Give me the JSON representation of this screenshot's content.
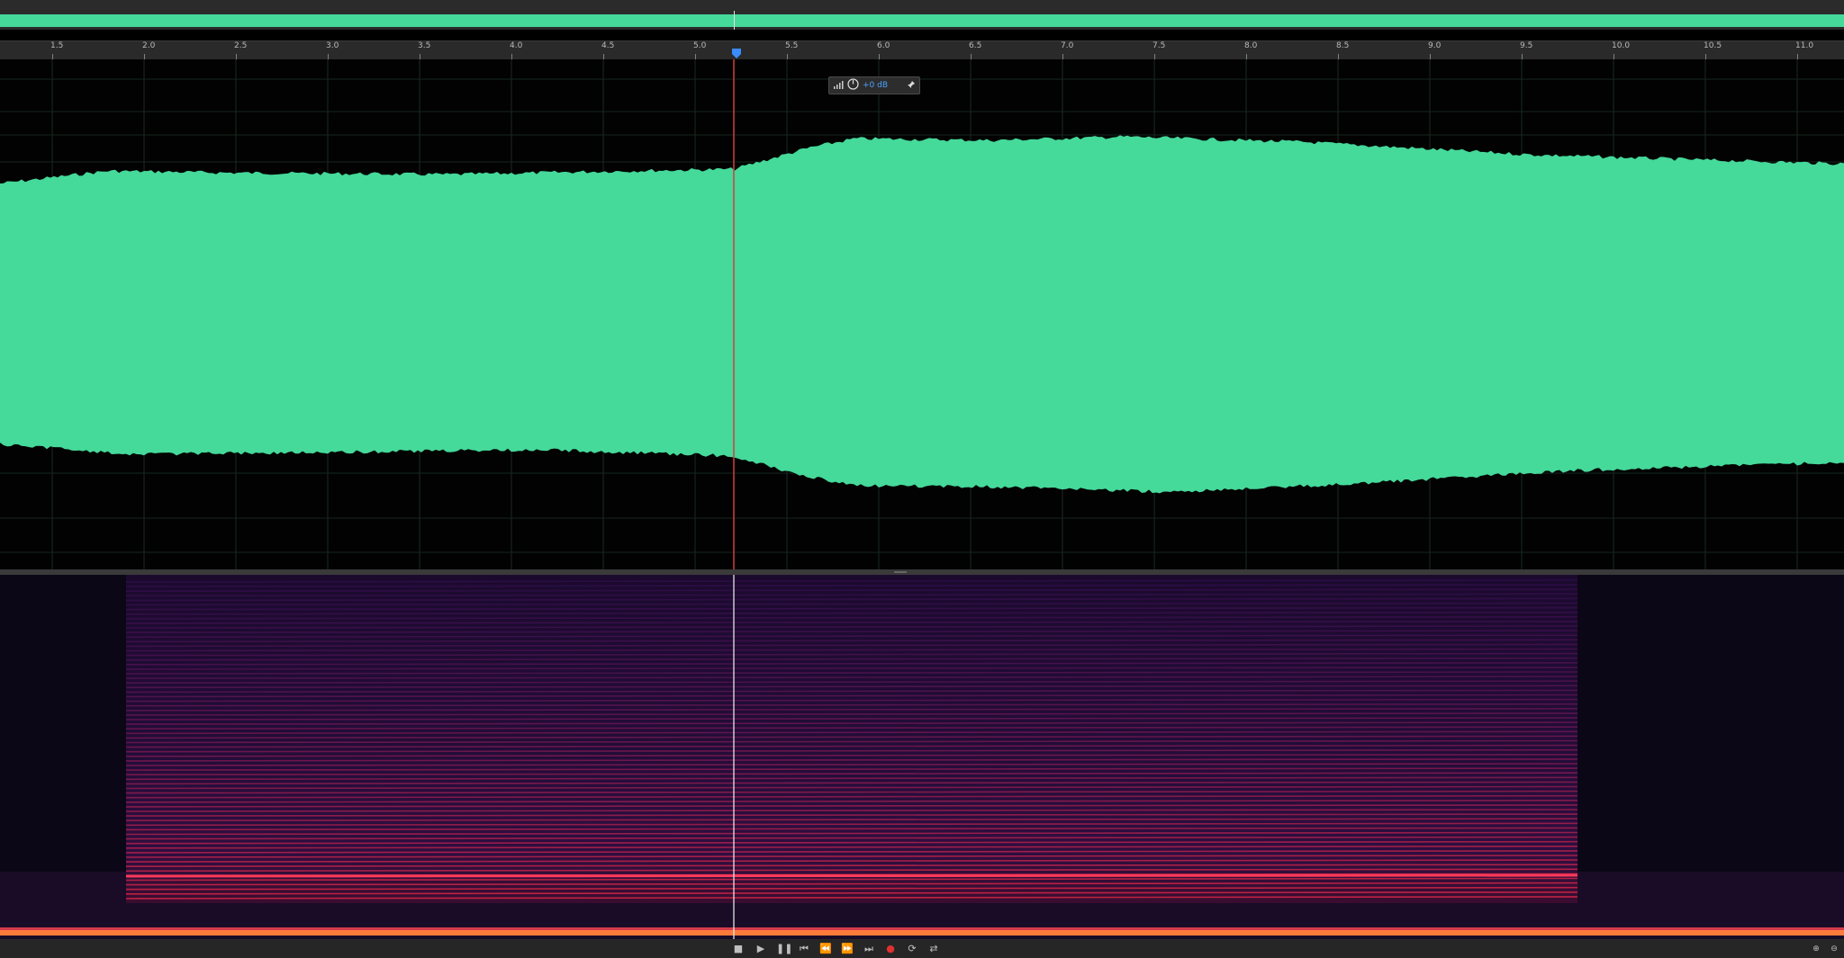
{
  "ruler": {
    "ticks": [
      "1.5",
      "2.0",
      "2.5",
      "3.0",
      "3.5",
      "4.0",
      "4.5",
      "5.0",
      "5.5",
      "6.0",
      "6.5",
      "7.0",
      "7.5",
      "8.0",
      "8.5",
      "9.0",
      "9.5",
      "10.0",
      "10.5",
      "11.0"
    ]
  },
  "hud": {
    "gain_label": "+0 dB",
    "icons": [
      "level-meter-icon",
      "knob-icon",
      "pin-icon"
    ]
  },
  "transport": {
    "buttons": [
      "stop",
      "play",
      "pause",
      "go-to-start",
      "rewind",
      "fast-forward",
      "go-to-end",
      "record",
      "loop",
      "skip-selection"
    ]
  },
  "colors": {
    "waveform": "#45d99a",
    "playhead_waveform": "#d04040",
    "playhead_spectral": "#f2f2f2",
    "background": "#000000"
  }
}
